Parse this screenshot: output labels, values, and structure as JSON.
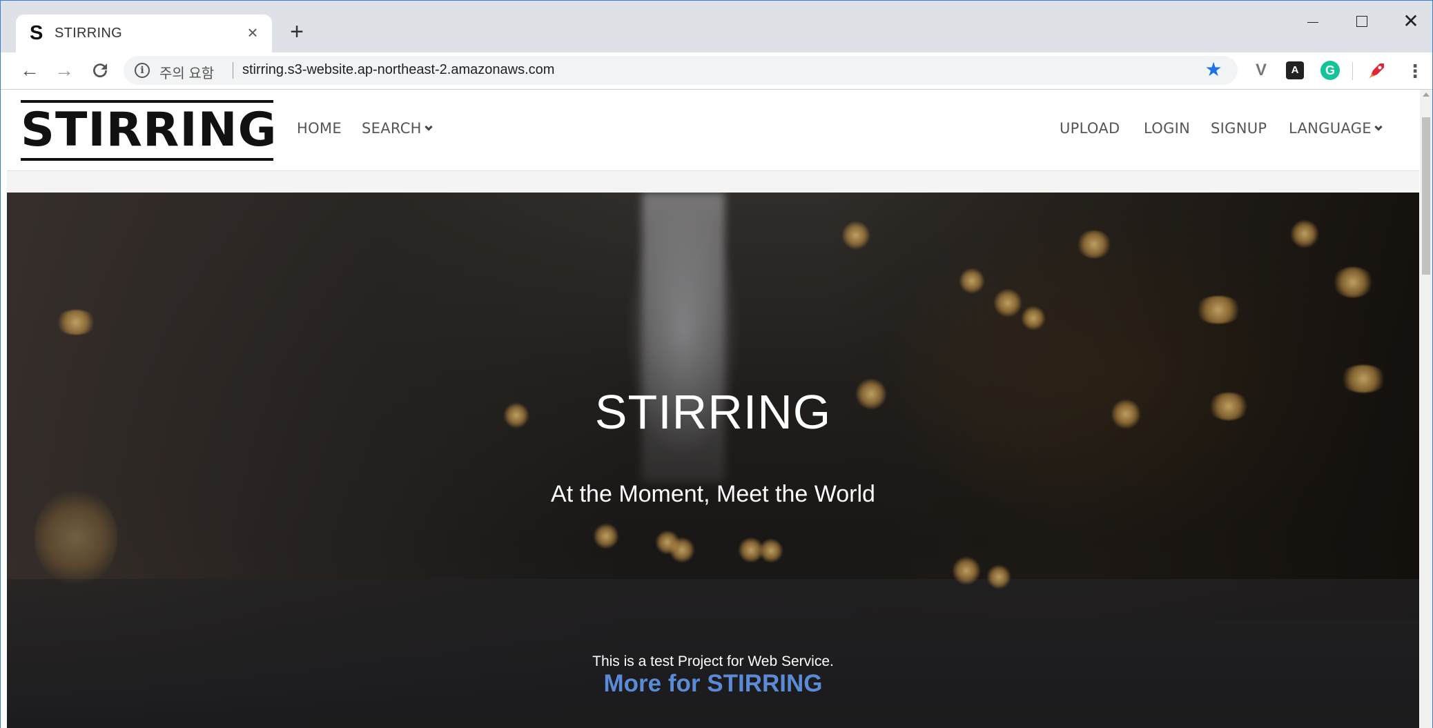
{
  "browser": {
    "tab": {
      "favicon": "S",
      "title": "STIRRING",
      "close": "×"
    },
    "new_tab": "+",
    "window_controls": {
      "minimize": "",
      "maximize": "",
      "close": "✕"
    },
    "nav": {
      "back": "←",
      "forward": "→",
      "reload": "C"
    },
    "omnibox": {
      "security_icon": "info-icon",
      "security_label": "주의 요함",
      "url": "stirring.s3-website.ap-northeast-2.amazonaws.com",
      "bookmark_icon": "star-icon"
    },
    "extensions": {
      "v": "V",
      "a": "A",
      "g": "G"
    },
    "menu": "⋮"
  },
  "site": {
    "logo": "STIRRING",
    "nav_left": [
      "HOME",
      "SEARCH"
    ],
    "nav_right": [
      "UPLOAD",
      "LOGIN",
      "SIGNUP",
      "LANGUAGE"
    ]
  },
  "hero": {
    "title": "STIRRING",
    "subtitle": "At the Moment, Meet the World",
    "note": "This is a test Project for Web Service.",
    "more_link": "More for STIRRING"
  }
}
